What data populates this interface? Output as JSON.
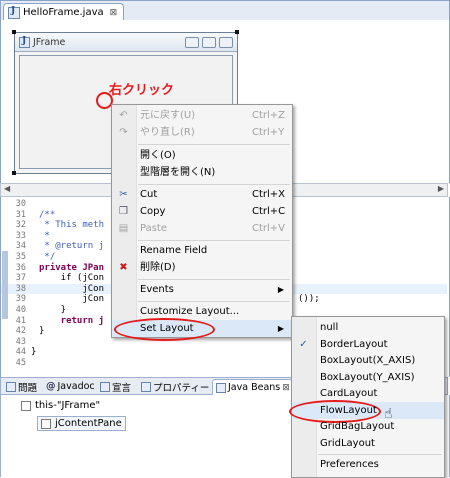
{
  "editor": {
    "tab_title": "HelloFrame.java",
    "tab_close": "⊠"
  },
  "jframe": {
    "title": "JFrame"
  },
  "annotation": {
    "right_click": "右クリック"
  },
  "code": {
    "lines": [
      {
        "num": "30",
        "text": ""
      },
      {
        "num": "31",
        "text": "/**"
      },
      {
        "num": "32",
        "text": " * This meth"
      },
      {
        "num": "33",
        "text": " * "
      },
      {
        "num": "34",
        "text": " * @return j"
      },
      {
        "num": "35",
        "text": " */"
      },
      {
        "num": "36",
        "text": "private JPan"
      },
      {
        "num": "37",
        "text": "    if (jCon"
      },
      {
        "num": "38",
        "text": "        jCon"
      },
      {
        "num": "39",
        "text": "        jCon"
      },
      {
        "num": "40",
        "text": "    }"
      },
      {
        "num": "41",
        "text": "    return j"
      },
      {
        "num": "42",
        "text": "}"
      },
      {
        "num": "43",
        "text": ""
      },
      {
        "num": "44",
        "text": "}"
      },
      {
        "num": "45",
        "text": ""
      }
    ],
    "line39_tail": "());"
  },
  "views": {
    "tabs": [
      {
        "label": "問題",
        "icon": "problems-icon"
      },
      {
        "label": "Javadoc",
        "icon": "javadoc-icon"
      },
      {
        "label": "宣言",
        "icon": "declaration-icon"
      },
      {
        "label": "プロパティー",
        "icon": "properties-icon"
      },
      {
        "label": "Java Beans",
        "icon": "java-beans-icon"
      }
    ],
    "tree": [
      {
        "label": "this-\"JFrame\""
      },
      {
        "label": "jContentPane"
      }
    ]
  },
  "context_menu": {
    "items": [
      {
        "label": "元に戻す(U)",
        "accel": "Ctrl+Z",
        "disabled": true,
        "icon": "undo-icon"
      },
      {
        "label": "やり直し(R)",
        "accel": "Ctrl+Y",
        "disabled": true,
        "icon": "redo-icon"
      },
      {
        "label": "開く(O)",
        "accel": "",
        "disabled": false
      },
      {
        "label": "型階層を開く(N)",
        "accel": "",
        "disabled": false
      },
      {
        "label": "Cut",
        "accel": "Ctrl+X",
        "disabled": false,
        "icon": "cut-icon"
      },
      {
        "label": "Copy",
        "accel": "Ctrl+C",
        "disabled": false,
        "icon": "copy-icon"
      },
      {
        "label": "Paste",
        "accel": "Ctrl+V",
        "disabled": true,
        "icon": "paste-icon"
      },
      {
        "label": "Rename Field",
        "accel": "",
        "disabled": false
      },
      {
        "label": "削除(D)",
        "accel": "",
        "disabled": false,
        "icon": "delete-icon"
      },
      {
        "label": "Events",
        "accel": "",
        "disabled": false,
        "submenu": true
      },
      {
        "label": "Customize Layout...",
        "accel": "",
        "disabled": false
      },
      {
        "label": "Set Layout",
        "accel": "",
        "disabled": false,
        "submenu": true
      }
    ]
  },
  "layout_submenu": {
    "items": [
      "null",
      "BorderLayout",
      "BoxLayout(X_AXIS)",
      "BoxLayout(Y_AXIS)",
      "CardLayout",
      "FlowLayout",
      "GridBagLayout",
      "GridLayout",
      "Preferences"
    ],
    "checked": "BorderLayout",
    "hovered": "FlowLayout"
  },
  "colors": {
    "annotation_red": "#e51a1a",
    "keyword": "#7f0055",
    "comment": "#3f5fbf"
  }
}
